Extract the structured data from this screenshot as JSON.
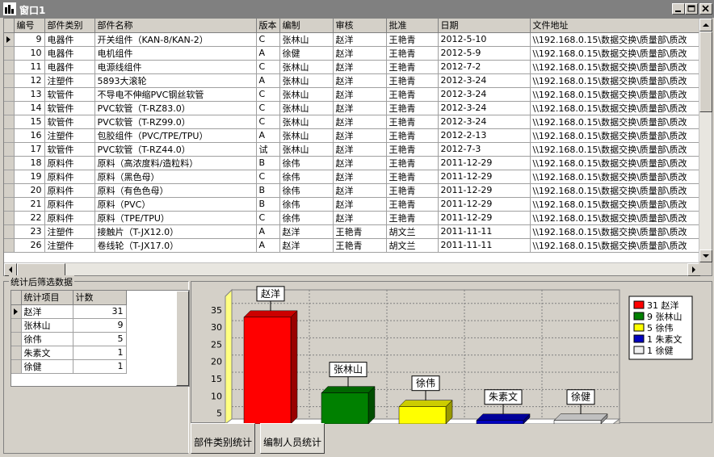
{
  "window": {
    "title": "窗口1"
  },
  "grid": {
    "columns": [
      "编号",
      "部件类别",
      "部件名称",
      "版本",
      "编制",
      "审核",
      "批准",
      "日期",
      "文件地址"
    ],
    "rows": [
      [
        "9",
        "电器件",
        "开关组件（KAN-8/KAN-2）",
        "C",
        "张林山",
        "赵洋",
        "王艳青",
        "2012-5-10",
        "\\\\192.168.0.15\\数据交换\\质量部\\质改"
      ],
      [
        "10",
        "电器件",
        "电机组件",
        "A",
        "徐健",
        "赵洋",
        "王艳青",
        "2012-5-9",
        "\\\\192.168.0.15\\数据交换\\质量部\\质改"
      ],
      [
        "11",
        "电器件",
        "电源线组件",
        "C",
        "张林山",
        "赵洋",
        "王艳青",
        "2012-7-2",
        "\\\\192.168.0.15\\数据交换\\质量部\\质改"
      ],
      [
        "12",
        "注塑件",
        "5893大滚轮",
        "A",
        "张林山",
        "赵洋",
        "王艳青",
        "2012-3-24",
        "\\\\192.168.0.15\\数据交换\\质量部\\质改"
      ],
      [
        "13",
        "软管件",
        "不导电不伸缩PVC钢丝软管",
        "C",
        "张林山",
        "赵洋",
        "王艳青",
        "2012-3-24",
        "\\\\192.168.0.15\\数据交换\\质量部\\质改"
      ],
      [
        "14",
        "软管件",
        "PVC软管（T-RZ83.0）",
        "C",
        "张林山",
        "赵洋",
        "王艳青",
        "2012-3-24",
        "\\\\192.168.0.15\\数据交换\\质量部\\质改"
      ],
      [
        "15",
        "软管件",
        "PVC软管（T-RZ99.0）",
        "C",
        "张林山",
        "赵洋",
        "王艳青",
        "2012-3-24",
        "\\\\192.168.0.15\\数据交换\\质量部\\质改"
      ],
      [
        "16",
        "注塑件",
        "包胶组件（PVC/TPE/TPU）",
        "A",
        "张林山",
        "赵洋",
        "王艳青",
        "2012-2-13",
        "\\\\192.168.0.15\\数据交换\\质量部\\质改"
      ],
      [
        "17",
        "软管件",
        "PVC软管（T-RZ44.0）",
        "试",
        "张林山",
        "赵洋",
        "王艳青",
        "2012-7-3",
        "\\\\192.168.0.15\\数据交换\\质量部\\质改"
      ],
      [
        "18",
        "原料件",
        "原料（高浓度料/造粒料）",
        "B",
        "徐伟",
        "赵洋",
        "王艳青",
        "2011-12-29",
        "\\\\192.168.0.15\\数据交换\\质量部\\质改"
      ],
      [
        "19",
        "原料件",
        "原料（黑色母）",
        "C",
        "徐伟",
        "赵洋",
        "王艳青",
        "2011-12-29",
        "\\\\192.168.0.15\\数据交换\\质量部\\质改"
      ],
      [
        "20",
        "原料件",
        "原料（有色色母）",
        "B",
        "徐伟",
        "赵洋",
        "王艳青",
        "2011-12-29",
        "\\\\192.168.0.15\\数据交换\\质量部\\质改"
      ],
      [
        "21",
        "原料件",
        "原料（PVC）",
        "B",
        "徐伟",
        "赵洋",
        "王艳青",
        "2011-12-29",
        "\\\\192.168.0.15\\数据交换\\质量部\\质改"
      ],
      [
        "22",
        "原料件",
        "原料（TPE/TPU）",
        "C",
        "徐伟",
        "赵洋",
        "王艳青",
        "2011-12-29",
        "\\\\192.168.0.15\\数据交换\\质量部\\质改"
      ],
      [
        "23",
        "注塑件",
        "接触片（T-JX12.0）",
        "A",
        "赵洋",
        "王艳青",
        "胡文兰",
        "2011-11-11",
        "\\\\192.168.0.15\\数据交换\\质量部\\质改"
      ],
      [
        "26",
        "注塑件",
        "卷线轮（T-JX17.0）",
        "A",
        "赵洋",
        "王艳青",
        "胡文兰",
        "2011-11-11",
        "\\\\192.168.0.15\\数据交换\\质量部\\质改"
      ]
    ]
  },
  "stats": {
    "group_label": "统计后筛选数据",
    "columns": [
      "统计项目",
      "计数"
    ],
    "rows": [
      [
        "赵洋",
        "31"
      ],
      [
        "张林山",
        "9"
      ],
      [
        "徐伟",
        "5"
      ],
      [
        "朱素文",
        "1"
      ],
      [
        "徐健",
        "1"
      ]
    ]
  },
  "tabs": [
    {
      "label": "部件类别统计",
      "active": false
    },
    {
      "label": "编制人员统计",
      "active": true
    }
  ],
  "chart_data": {
    "type": "bar",
    "categories": [
      "赵洋",
      "张林山",
      "徐伟",
      "朱素文",
      "徐健"
    ],
    "values": [
      31,
      9,
      5,
      1,
      1
    ],
    "colors": [
      "#ff0000",
      "#008000",
      "#ffff00",
      "#0000c0",
      "#f0f0f0"
    ],
    "yticks": [
      5,
      10,
      15,
      20,
      25,
      30,
      35
    ],
    "ylim": [
      0,
      38
    ],
    "grid": true,
    "legend_position": "top-right",
    "legend_entries": [
      "31 赵洋",
      "9 张林山",
      "5 徐伟",
      "1 朱素文",
      "1 徐健"
    ]
  }
}
